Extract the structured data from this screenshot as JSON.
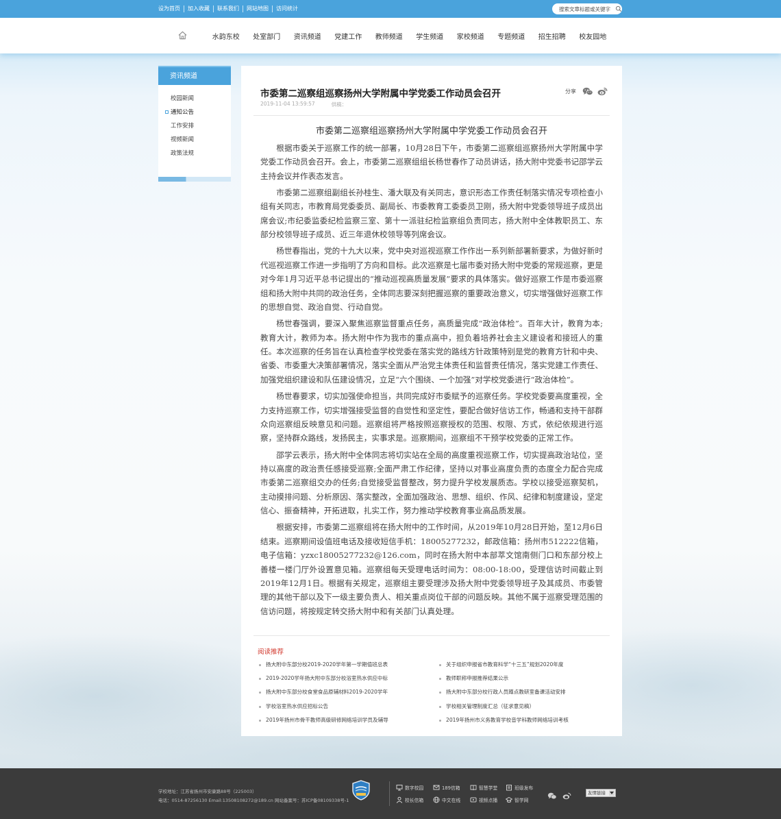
{
  "topbar": {
    "links": [
      "设为首页",
      "加入收藏",
      "联系我们",
      "网站地图",
      "访问统计"
    ],
    "search_placeholder": "搜索文章标题或关键字"
  },
  "nav": {
    "items": [
      "水韵东校",
      "处室部门",
      "资讯频道",
      "党建工作",
      "教师频道",
      "学生频道",
      "家校频道",
      "专题频道",
      "招生招聘",
      "校友园地"
    ]
  },
  "sidebar": {
    "title": "资讯频道",
    "items": [
      {
        "label": "校园新闻",
        "active": false
      },
      {
        "label": "通知公告",
        "active": true
      },
      {
        "label": "工作安排",
        "active": false
      },
      {
        "label": "视频新闻",
        "active": false
      },
      {
        "label": "政策法规",
        "active": false
      }
    ]
  },
  "article": {
    "title": "市委第二巡察组巡察扬州大学附属中学党委工作动员会召开",
    "date": "2019-11-04 13:59:57",
    "source_label": "供稿：",
    "share_label": "分享",
    "heading": "市委第二巡察组巡察扬州大学附属中学党委工作动员会召开",
    "paragraphs": [
      "根据市委关于巡察工作的统一部署，10月28日下午，市委第二巡察组巡察扬州大学附属中学党委工作动员会召开。会上，市委第二巡察组组长杨世春作了动员讲话，扬大附中党委书记邵学云主持会议并作表态发言。",
      "市委第二巡察组副组长孙桂生、潘大联及有关同志，意识形态工作责任制落实情况专项检查小组有关同志，市教育局党委委员、副局长、市委教育工委委员卫刚，扬大附中党委领导班子成员出席会议;市纪委监委纪检监察三室、第十一派驻纪检监察组负责同志，扬大附中全体教职员工、东部分校领导班子成员、近三年退休校领导等列席会议。",
      "杨世春指出，党的十九大以来，党中央对巡视巡察工作作出一系列新部署新要求，为做好新时代巡视巡察工作进一步指明了方向和目标。此次巡察是七届市委对扬大附中党委的常规巡察，更是对今年1月习近平总书记提出的“推动巡视高质量发展”要求的具体落实。做好巡察工作是市委巡察组和扬大附中共同的政治任务，全体同志要深刻把握巡察的重要政治意义，切实增强做好巡察工作的思想自觉、政治自觉、行动自觉。",
      "杨世春强调，要深入聚焦巡察监督重点任务，高质量完成“政治体检”。百年大计，教育为本;教育大计，教师为本。扬大附中作为我市的重点高中，担负着培养社会主义建设者和接班人的重任。本次巡察的任务旨在认真检查学校党委在落实党的路线方针政策特别是党的教育方针和中央、省委、市委重大决策部署情况，落实全面从严治党主体责任和监督责任情况，落实党建工作责任、加强党组织建设和队伍建设情况，立足“六个围绕、一个加强”对学校党委进行“政治体检”。",
      "杨世春要求，切实加强使命担当，共同完成好市委赋予的巡察任务。学校党委要高度重视，全力支持巡察工作，切实增强接受监督的自觉性和坚定性，要配合做好信访工作，畅通和支持干部群众向巡察组反映意见和问题。巡察组将严格按照巡察授权的范围、权限、方式，依纪依规进行巡察，坚持群众路线，发扬民主，实事求是。巡察期间，巡察组不干预学校党委的正常工作。",
      "邵学云表示，扬大附中全体同志将切实站在全局的高度重视巡察工作，切实提高政治站位，坚持以高度的政治责任感接受巡察;全面严肃工作纪律，坚持以对事业高度负责的态度全力配合完成市委第二巡察组交办的任务;自觉接受监督整改，努力提升学校发展质态。学校以接受巡察契机，主动摸排问题、分析原因、落实整改，全面加强政治、思想、组织、作风、纪律和制度建设，坚定信心、振奋精神，开拓进取，扎实工作，努力推动学校教育事业高品质发展。",
      "根据安排，市委第二巡察组将在扬大附中的工作时间，从2019年10月28日开始，至12月6日结束。巡察期间设值班电话及接收短信手机：18005277232，邮政信箱：扬州市512222信箱，电子信箱：yzxc18005277232@126.com，同时在扬大附中本部萃文馆南侧门口和东部分校上善楼一楼门厅外设置意见箱。巡察组每天受理电话时间为：08:00-18:00，受理信访时间截止到2019年12月1日。根据有关规定，巡察组主要受理涉及扬大附中党委领导班子及其成员、市委管理的其他干部以及下一级主要负责人、相关重点岗位干部的问题反映。其他不属于巡察受理范围的信访问题，将按规定转交扬大附中和有关部门认真处理。"
    ]
  },
  "recommend": {
    "title": "阅读推荐",
    "left": [
      "扬大附中东部分校2019-2020学年第一学期值班总表",
      "2019-2020学年扬大附中东部分校浴室热水供应中标",
      "扬大附中东部分校食堂食品原辅材料2019-2020学年",
      "学校浴室热水供应招标公告",
      "2019年扬州市骨干教师高级研修网络培训学员及辅导"
    ],
    "right": [
      "关于组织申报省市教育科学“十三五”规划2020年度",
      "教师职称申报推荐结果公示",
      "扬大附中东部分校行政人员蹲点教研室备课活动安排",
      "学校相关管理制度汇总（征求意见稿）",
      "2019年扬州市义务教育学校音学科教师网络培训考核"
    ]
  },
  "footer": {
    "address": "学校地址：江苏省扬州市安康路88号（225003）",
    "contact": "电话：0514-87256130  Email:13508108272@189.cn 网站备案号：苏ICP备08109338号-1",
    "links": [
      {
        "label": "数字校园",
        "icon": "monitor-icon"
      },
      {
        "label": "189信箱",
        "icon": "mail-icon"
      },
      {
        "label": "智慧学堂",
        "icon": "book-icon"
      },
      {
        "label": "班级发布",
        "icon": "clipboard-icon"
      },
      {
        "label": "校长信箱",
        "icon": "user-icon"
      },
      {
        "label": "中文在线",
        "icon": "globe-icon"
      },
      {
        "label": "视频点播",
        "icon": "video-icon"
      },
      {
        "label": "智学网",
        "icon": "cap-icon"
      }
    ],
    "friend_links": "友情链接"
  },
  "colors": {
    "accent": "#4aa3dc",
    "footer_bg": "#3b3b3b",
    "recommend_title": "#d23a2f"
  }
}
